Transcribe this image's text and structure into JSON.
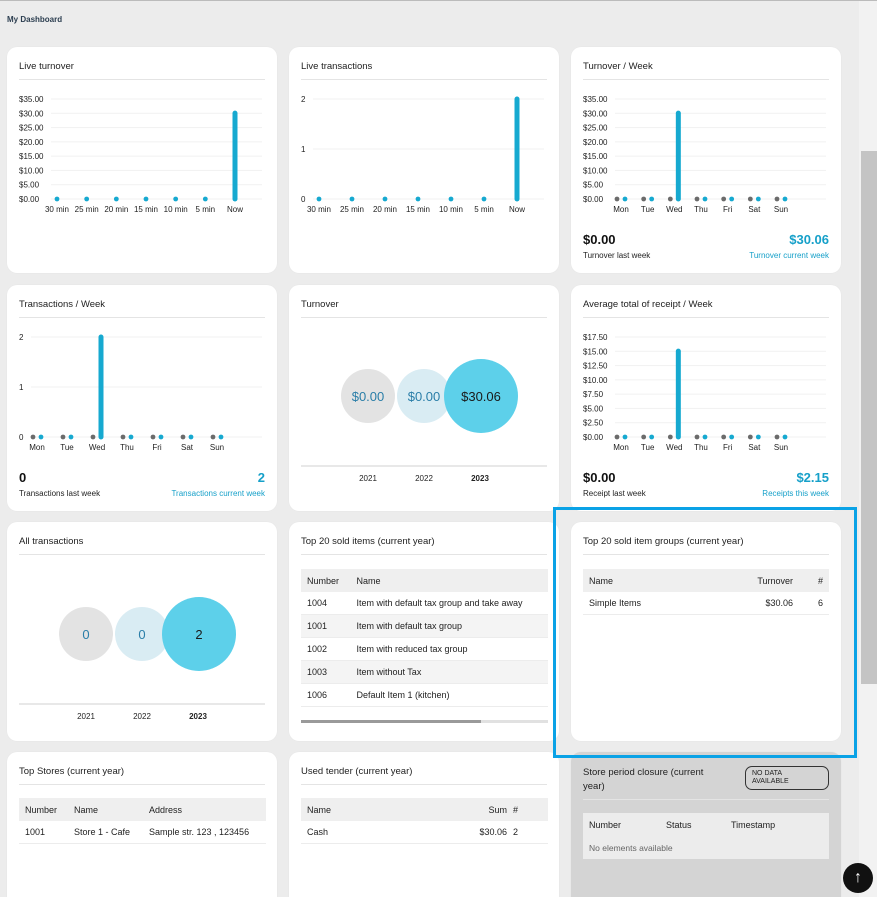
{
  "page_title": "My Dashboard",
  "cards": {
    "live_turnover": {
      "title": "Live turnover"
    },
    "live_transactions": {
      "title": "Live transactions"
    },
    "turnover_week": {
      "title": "Turnover / Week",
      "last_value": "$0.00",
      "current_value": "$30.06",
      "last_label": "Turnover last week",
      "current_label": "Turnover current week"
    },
    "transactions_week": {
      "title": "Transactions / Week",
      "last_value": "0",
      "current_value": "2",
      "last_label": "Transactions last week",
      "current_label": "Transactions current week"
    },
    "turnover": {
      "title": "Turnover"
    },
    "avg_receipt_week": {
      "title": "Average total of receipt / Week",
      "last_value": "$0.00",
      "current_value": "$2.15",
      "last_label": "Receipt last week",
      "current_label": "Receipts this week"
    },
    "all_transactions": {
      "title": "All transactions"
    },
    "top_sold_items": {
      "title": "Top 20 sold items (current year)",
      "columns": [
        "Number",
        "Name"
      ],
      "rows": [
        [
          "1004",
          "Item with default tax group and take away"
        ],
        [
          "1001",
          "Item with default tax group"
        ],
        [
          "1002",
          "Item with reduced tax group"
        ],
        [
          "1003",
          "Item without Tax"
        ],
        [
          "1006",
          "Default Item 1 (kitchen)"
        ]
      ]
    },
    "top_item_groups": {
      "title": "Top 20 sold item groups (current year)",
      "columns": [
        "Name",
        "Turnover",
        "#"
      ],
      "rows": [
        [
          "Simple Items",
          "$30.06",
          "6"
        ]
      ]
    },
    "top_stores": {
      "title": "Top Stores (current year)",
      "columns": [
        "Number",
        "Name",
        "Address"
      ],
      "rows": [
        [
          "1001",
          "Store 1 - Cafe",
          "Sample str. 123 , 123456"
        ]
      ]
    },
    "used_tender": {
      "title": "Used tender (current year)",
      "columns": [
        "Name",
        "Sum",
        "#"
      ],
      "rows": [
        [
          "Cash",
          "$30.06",
          "2"
        ]
      ]
    },
    "store_period_closure": {
      "title_line1": "Store period closure (current",
      "title_line2": "year)",
      "badge_line1": "NO DATA",
      "badge_line2": "AVAILABLE",
      "columns": [
        "Number",
        "Status",
        "Timestamp"
      ],
      "empty": "No elements available"
    }
  },
  "chart_data": [
    {
      "id": "live_turnover",
      "type": "bar",
      "categories": [
        "30 min",
        "25 min",
        "20 min",
        "15 min",
        "10 min",
        "5 min",
        "Now"
      ],
      "values": [
        0,
        0,
        0,
        0,
        0,
        0,
        30.06
      ],
      "yticks": [
        "$0.00",
        "$5.00",
        "$10.00",
        "$15.00",
        "$20.00",
        "$25.00",
        "$30.00",
        "$35.00"
      ],
      "ylim": [
        0,
        35
      ]
    },
    {
      "id": "live_transactions",
      "type": "bar",
      "categories": [
        "30 min",
        "25 min",
        "20 min",
        "15 min",
        "10 min",
        "5 min",
        "Now"
      ],
      "values": [
        0,
        0,
        0,
        0,
        0,
        0,
        2
      ],
      "yticks": [
        "0",
        "1",
        "2"
      ],
      "ylim": [
        0,
        2
      ]
    },
    {
      "id": "turnover_week",
      "type": "bar",
      "categories": [
        "Mon",
        "Tue",
        "Wed",
        "Thu",
        "Fri",
        "Sat",
        "Sun"
      ],
      "series": [
        {
          "values": [
            0,
            0,
            0,
            0,
            0,
            0,
            0
          ]
        },
        {
          "values": [
            0,
            0,
            30.06,
            0,
            0,
            0,
            0
          ]
        }
      ],
      "yticks": [
        "$0.00",
        "$5.00",
        "$10.00",
        "$15.00",
        "$20.00",
        "$25.00",
        "$30.00",
        "$35.00"
      ],
      "ylim": [
        0,
        35
      ]
    },
    {
      "id": "transactions_week",
      "type": "bar",
      "categories": [
        "Mon",
        "Tue",
        "Wed",
        "Thu",
        "Fri",
        "Sat",
        "Sun"
      ],
      "series": [
        {
          "values": [
            0,
            0,
            0,
            0,
            0,
            0,
            0
          ]
        },
        {
          "values": [
            0,
            0,
            2,
            0,
            0,
            0,
            0
          ]
        }
      ],
      "yticks": [
        "0",
        "1",
        "2"
      ],
      "ylim": [
        0,
        2
      ]
    },
    {
      "id": "avg_receipt_week",
      "type": "bar",
      "categories": [
        "Mon",
        "Tue",
        "Wed",
        "Thu",
        "Fri",
        "Sat",
        "Sun"
      ],
      "series": [
        {
          "values": [
            0,
            0,
            0,
            0,
            0,
            0,
            0
          ]
        },
        {
          "values": [
            0,
            0,
            15.03,
            0,
            0,
            0,
            0
          ]
        }
      ],
      "yticks": [
        "$0.00",
        "$2.50",
        "$5.00",
        "$7.50",
        "$10.00",
        "$12.50",
        "$15.00",
        "$17.50"
      ],
      "ylim": [
        0,
        17.5
      ]
    },
    {
      "id": "turnover",
      "type": "bubble",
      "categories": [
        "2021",
        "2022",
        "2023"
      ],
      "values": [
        0,
        0,
        30.06
      ],
      "labels": [
        "$0.00",
        "$0.00",
        "$30.06"
      ]
    },
    {
      "id": "all_transactions",
      "type": "bubble",
      "categories": [
        "2021",
        "2022",
        "2023"
      ],
      "values": [
        0,
        0,
        2
      ],
      "labels": [
        "0",
        "0",
        "2"
      ]
    }
  ],
  "colors": {
    "accent": "#16a0c9",
    "bar": "#16a9d0",
    "dot_prev": "#6b6b6b",
    "highlight": "#0aa2e6"
  }
}
